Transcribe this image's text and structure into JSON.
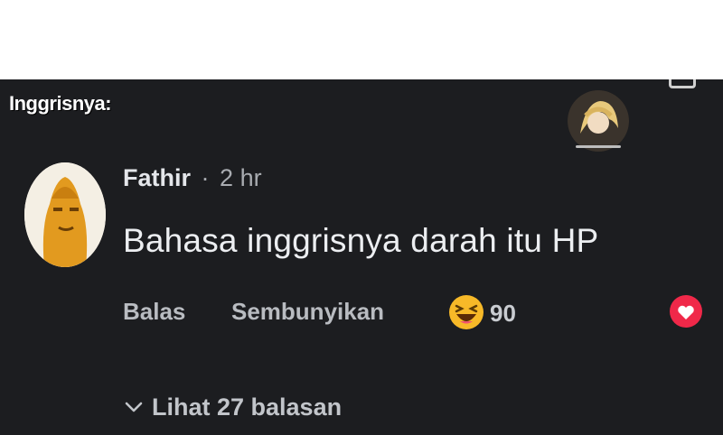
{
  "overlay_label": "Inggrisnya:",
  "comment": {
    "author": "Fathir",
    "separator": "·",
    "time": "2 hr",
    "text": "Bahasa inggrisnya darah itu HP",
    "reaction_count": "90",
    "actions": {
      "reply_label": "Balas",
      "hide_label": "Sembunyikan"
    },
    "view_replies_label": "Lihat 27 balasan"
  },
  "colors": {
    "panel_background": "#1c1d20",
    "love_reaction": "#f02849",
    "haha_reaction": "#f7b928"
  }
}
